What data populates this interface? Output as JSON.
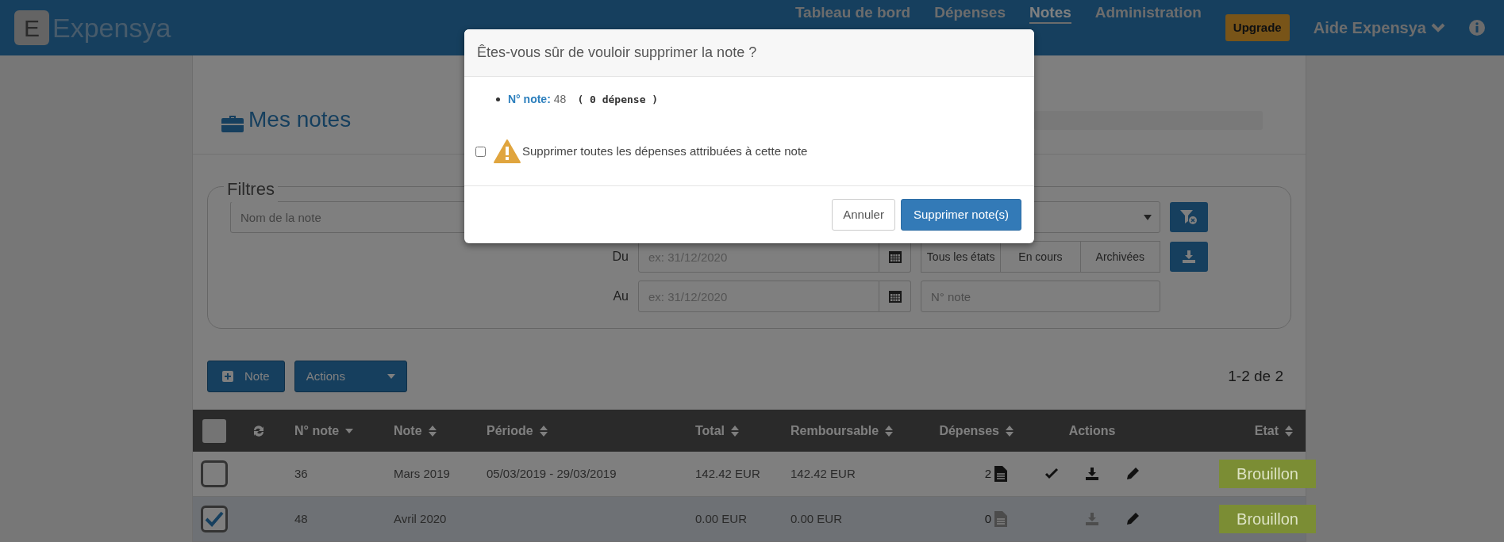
{
  "nav": {
    "brand": "Expensya",
    "brand_letter": "E",
    "items": [
      {
        "label": "Tableau de bord",
        "selected": false
      },
      {
        "label": "Dépenses",
        "selected": false
      },
      {
        "label": "Notes",
        "selected": true
      },
      {
        "label": "Administration",
        "selected": false
      }
    ],
    "upgrade": "Upgrade",
    "help": "Aide Expensya"
  },
  "page": {
    "title": "Mes notes",
    "progress": {
      "level": 0
    }
  },
  "filters": {
    "legend": "Filtres",
    "name_placeholder": "Nom de la note",
    "from_label": "Du",
    "from_placeholder": "ex: 31/12/2020",
    "to_label": "Au",
    "to_placeholder": "ex: 31/12/2020",
    "state_buttons": [
      "Tous les états",
      "En cours",
      "Archivées"
    ],
    "number_placeholder": "N° note"
  },
  "toolbar": {
    "new_button": "Note",
    "actions_button": "Actions",
    "pagination": "1-2 de 2"
  },
  "table": {
    "select_all_checked": false,
    "columns": [
      {
        "label": "N° note",
        "sortable": true,
        "sorted_desc": true
      },
      {
        "label": "Note",
        "sortable": true,
        "sorted_desc": false
      },
      {
        "label": "Période",
        "sortable": true,
        "sorted_desc": false
      },
      {
        "label": "Total",
        "sortable": true,
        "sorted_desc": false
      },
      {
        "label": "Remboursable",
        "sortable": true,
        "sorted_desc": false
      },
      {
        "label": "Dépenses",
        "sortable": true,
        "sorted_desc": false
      },
      {
        "label": "Actions",
        "sortable": false
      },
      {
        "label": "Etat",
        "sortable": true,
        "sorted_desc": false
      }
    ],
    "rows": [
      {
        "checked": false,
        "number": "36",
        "note": "Mars 2019",
        "period": "05/03/2019 - 29/03/2019",
        "total": "142.42 EUR",
        "refundable": "142.42 EUR",
        "expenses": "2",
        "has_expenses": true,
        "actions": [
          {
            "kind": "validate",
            "disabled": false
          },
          {
            "kind": "download",
            "disabled": false
          },
          {
            "kind": "edit",
            "disabled": false
          }
        ],
        "status": "Brouillon"
      },
      {
        "checked": true,
        "number": "48",
        "note": "Avril 2020",
        "total": "0.00 EUR",
        "refundable": "0.00 EUR",
        "expenses": "0",
        "has_expenses": false,
        "actions": [
          {
            "kind": "download",
            "disabled": true
          },
          {
            "kind": "edit",
            "disabled": false
          }
        ],
        "status": "Brouillon"
      }
    ]
  },
  "modal": {
    "title": "Êtes-vous sûr de vouloir supprimer la note ?",
    "item_label": "N° note:",
    "item_value": "48",
    "item_count": "( 0 dépense )",
    "checkbox": {
      "label": "Supprimer toutes les dépenses attribuées à cette note",
      "checked": false
    },
    "cancel": "Annuler",
    "confirm": "Supprimer note(s)"
  }
}
